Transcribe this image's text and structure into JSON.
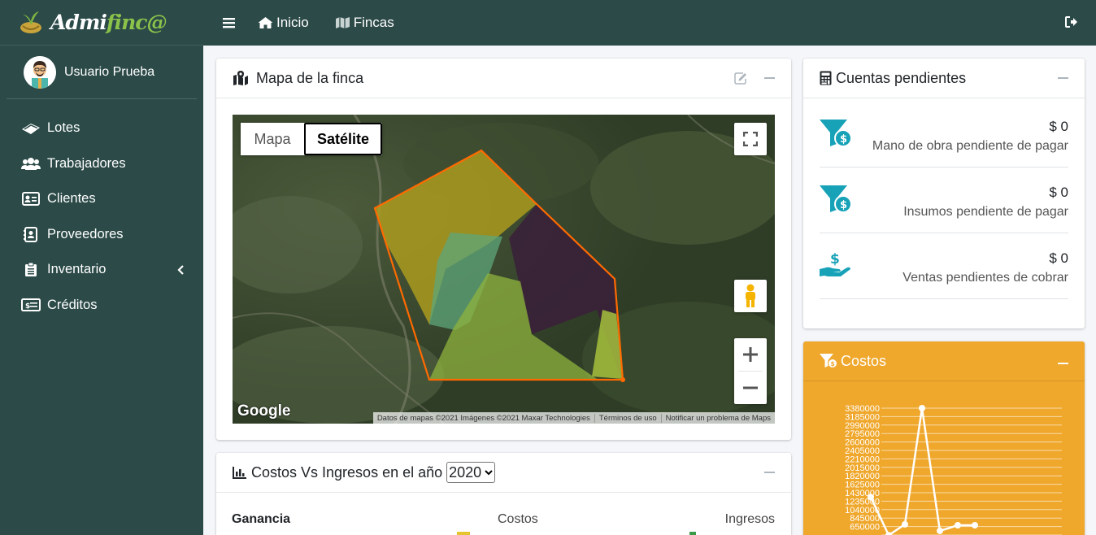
{
  "brand": {
    "name_prefix": "Admi",
    "name_accent": "finc@"
  },
  "user": {
    "name": "Usuario Prueba"
  },
  "sidebar": {
    "items": [
      {
        "label": "Lotes",
        "icon": "map-tag-icon"
      },
      {
        "label": "Trabajadores",
        "icon": "users-icon"
      },
      {
        "label": "Clientes",
        "icon": "address-card-icon"
      },
      {
        "label": "Proveedores",
        "icon": "address-book-icon"
      },
      {
        "label": "Inventario",
        "icon": "clipboard-icon"
      },
      {
        "label": "Créditos",
        "icon": "money-bill-icon"
      }
    ]
  },
  "topbar": {
    "home_label": "Inicio",
    "fincas_label": "Fincas"
  },
  "map_card": {
    "title": "Mapa de la finca",
    "map_type_map": "Mapa",
    "map_type_satellite": "Satélite",
    "google": "Google",
    "attrib_data": "Datos de mapas ©2021 Imágenes ©2021 Maxar Technologies",
    "attrib_terms": "Términos de uso",
    "attrib_report": "Notificar un problema de Maps"
  },
  "chart_card": {
    "title": "Costos Vs Ingresos en el año",
    "year": "2020",
    "ganancia": "Ganancia",
    "costos": "Costos",
    "ingresos": "Ingresos"
  },
  "cuentas": {
    "title": "Cuentas pendientes",
    "items": [
      {
        "amount": "$ 0",
        "label": "Mano de obra pendiente de pagar"
      },
      {
        "amount": "$ 0",
        "label": "Insumos pendiente de pagar"
      },
      {
        "amount": "$ 0",
        "label": "Ventas pendientes de cobrar"
      }
    ]
  },
  "costos": {
    "title": "Costos"
  },
  "chart_data": {
    "type": "line",
    "yticks": [
      "3380000",
      "3185000",
      "2990000",
      "2795000",
      "2600000",
      "2405000",
      "2210000",
      "2015000",
      "1820000",
      "1625000",
      "1430000",
      "1235000",
      "1040000",
      "845000",
      "650000"
    ],
    "series": [
      {
        "values": [
          1330000,
          450000,
          700000,
          3380000,
          550000,
          680000,
          680000
        ]
      }
    ],
    "ylim": [
      455000,
      3380000
    ]
  },
  "colors": {
    "sidebar": "#2b4a48",
    "accent_teal": "#17a2b8",
    "costos_orange": "#efa72c",
    "polygon_stroke": "#ff6a00"
  }
}
